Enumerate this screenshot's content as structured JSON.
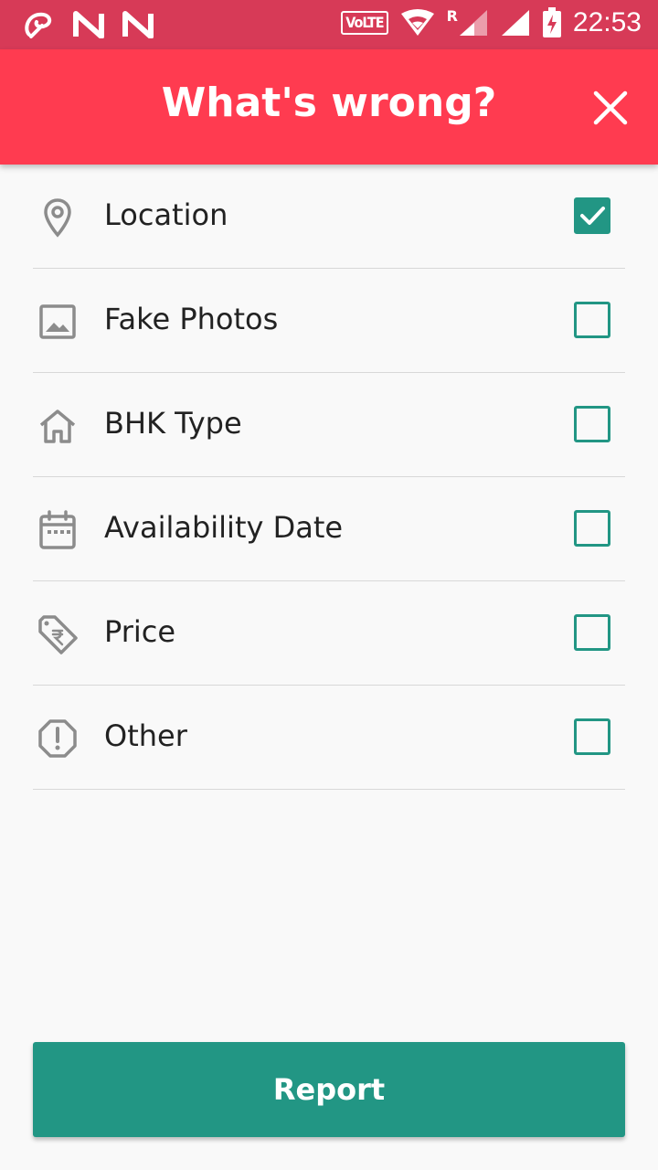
{
  "status_bar": {
    "volte": "VoLTE",
    "roaming": "R",
    "time": "22:53",
    "icons": [
      "airtel-icon",
      "notification-n-icon",
      "notification-n-icon",
      "volte-icon",
      "wifi-icon",
      "signal-icon",
      "signal-icon",
      "battery-charging-icon"
    ]
  },
  "header": {
    "title": "What's wrong?",
    "close_icon": "close-icon"
  },
  "options": [
    {
      "label": "Location",
      "icon": "location-pin-icon",
      "checked": true
    },
    {
      "label": "Fake Photos",
      "icon": "image-icon",
      "checked": false
    },
    {
      "label": "BHK Type",
      "icon": "house-icon",
      "checked": false
    },
    {
      "label": "Availability Date",
      "icon": "calendar-icon",
      "checked": false
    },
    {
      "label": "Price",
      "icon": "price-tag-icon",
      "checked": false
    },
    {
      "label": "Other",
      "icon": "alert-octagon-icon",
      "checked": false
    }
  ],
  "report_button": {
    "label": "Report"
  },
  "colors": {
    "status_bar": "#d73a57",
    "header": "#ff3b50",
    "accent": "#229684",
    "background": "#f9f9f9"
  }
}
